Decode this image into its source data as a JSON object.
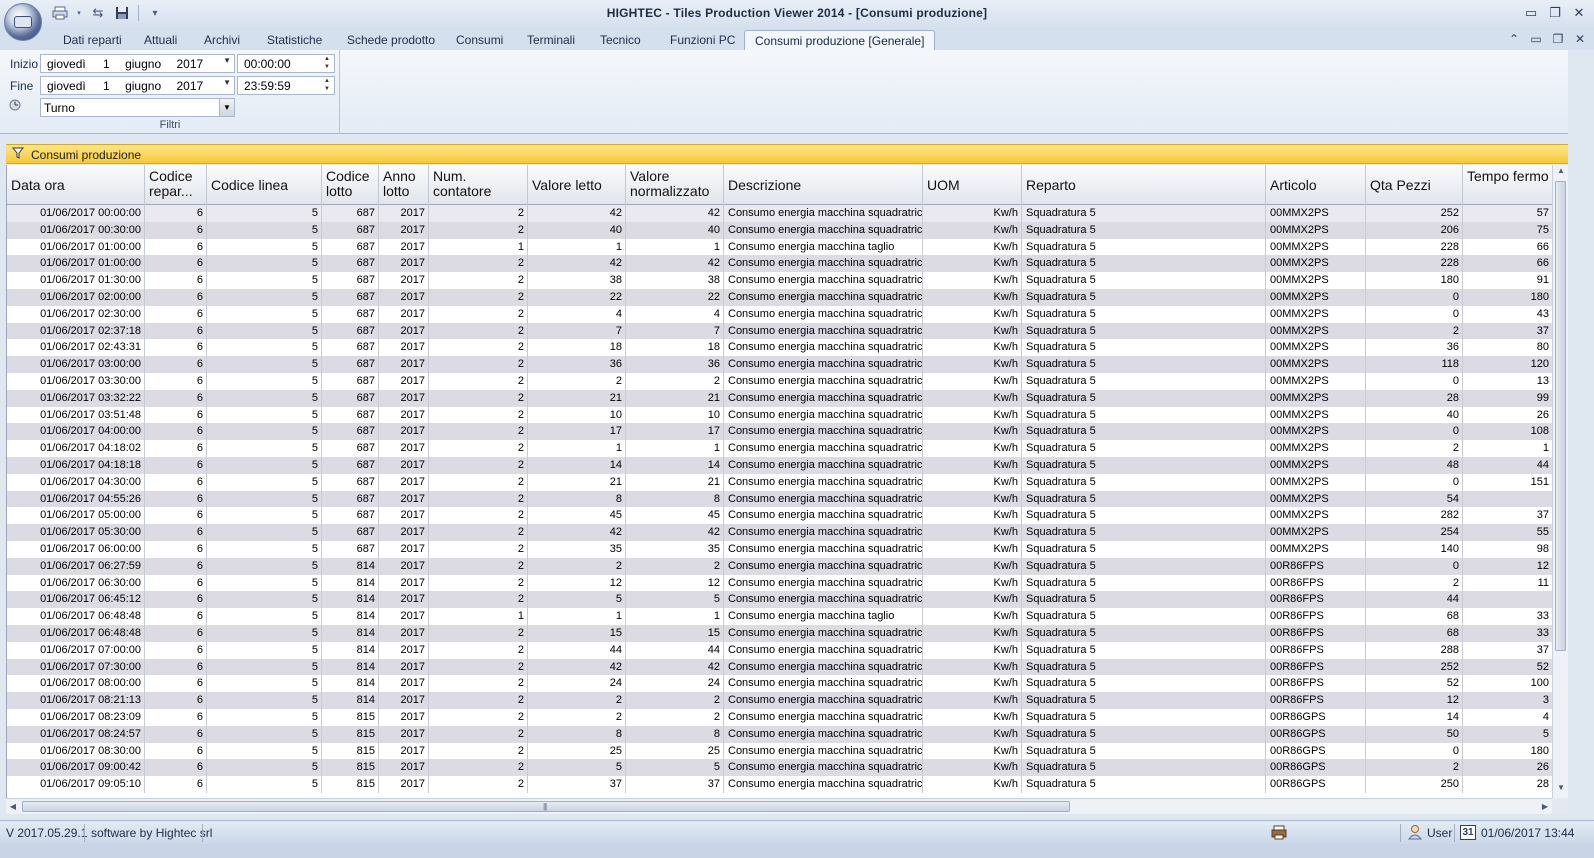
{
  "window": {
    "title": "HIGHTEC - Tiles Production Viewer 2014 - [Consumi produzione]"
  },
  "tabs": [
    "Dati reparti",
    "Attuali",
    "Archivi",
    "Statistiche",
    "Schede prodotto",
    "Consumi",
    "Terminali",
    "Tecnico",
    "Funzioni PC",
    "Consumi produzione [Generale]"
  ],
  "filters": {
    "start_label": "Inizio",
    "end_label": "Fine",
    "start_day": "giovedì",
    "start_num": "1",
    "start_month": "giugno",
    "start_year": "2017",
    "start_time": "00:00:00",
    "end_day": "giovedì",
    "end_num": "1",
    "end_month": "giugno",
    "end_year": "2017",
    "end_time": "23:59:59",
    "shift_value": "Turno",
    "group_caption": "Filtri"
  },
  "panel": {
    "title": "Consumi produzione"
  },
  "columns": [
    "Data ora",
    "Codice repar...",
    "Codice linea",
    "Codice lotto",
    "Anno lotto",
    "Num. contatore",
    "Valore letto",
    "Valore normalizzato",
    "Descrizione",
    "UOM",
    "Reparto",
    "Articolo",
    "Qta Pezzi",
    "Tempo fermo"
  ],
  "rows": [
    [
      "01/06/2017 00:00:00",
      "6",
      "5",
      "687",
      "2017",
      "2",
      "42",
      "42",
      "Consumo energia macchina squadratrice",
      "Kw/h",
      "Squadratura 5",
      "00MMX2PS",
      "252",
      "57"
    ],
    [
      "01/06/2017 00:30:00",
      "6",
      "5",
      "687",
      "2017",
      "2",
      "40",
      "40",
      "Consumo energia macchina squadratrice",
      "Kw/h",
      "Squadratura 5",
      "00MMX2PS",
      "206",
      "75"
    ],
    [
      "01/06/2017 01:00:00",
      "6",
      "5",
      "687",
      "2017",
      "1",
      "1",
      "1",
      "Consumo energia macchina taglio",
      "Kw/h",
      "Squadratura 5",
      "00MMX2PS",
      "228",
      "66"
    ],
    [
      "01/06/2017 01:00:00",
      "6",
      "5",
      "687",
      "2017",
      "2",
      "42",
      "42",
      "Consumo energia macchina squadratrice",
      "Kw/h",
      "Squadratura 5",
      "00MMX2PS",
      "228",
      "66"
    ],
    [
      "01/06/2017 01:30:00",
      "6",
      "5",
      "687",
      "2017",
      "2",
      "38",
      "38",
      "Consumo energia macchina squadratrice",
      "Kw/h",
      "Squadratura 5",
      "00MMX2PS",
      "180",
      "91"
    ],
    [
      "01/06/2017 02:00:00",
      "6",
      "5",
      "687",
      "2017",
      "2",
      "22",
      "22",
      "Consumo energia macchina squadratrice",
      "Kw/h",
      "Squadratura 5",
      "00MMX2PS",
      "0",
      "180"
    ],
    [
      "01/06/2017 02:30:00",
      "6",
      "5",
      "687",
      "2017",
      "2",
      "4",
      "4",
      "Consumo energia macchina squadratrice",
      "Kw/h",
      "Squadratura 5",
      "00MMX2PS",
      "0",
      "43"
    ],
    [
      "01/06/2017 02:37:18",
      "6",
      "5",
      "687",
      "2017",
      "2",
      "7",
      "7",
      "Consumo energia macchina squadratrice",
      "Kw/h",
      "Squadratura 5",
      "00MMX2PS",
      "2",
      "37"
    ],
    [
      "01/06/2017 02:43:31",
      "6",
      "5",
      "687",
      "2017",
      "2",
      "18",
      "18",
      "Consumo energia macchina squadratrice",
      "Kw/h",
      "Squadratura 5",
      "00MMX2PS",
      "36",
      "80"
    ],
    [
      "01/06/2017 03:00:00",
      "6",
      "5",
      "687",
      "2017",
      "2",
      "36",
      "36",
      "Consumo energia macchina squadratrice",
      "Kw/h",
      "Squadratura 5",
      "00MMX2PS",
      "118",
      "120"
    ],
    [
      "01/06/2017 03:30:00",
      "6",
      "5",
      "687",
      "2017",
      "2",
      "2",
      "2",
      "Consumo energia macchina squadratrice",
      "Kw/h",
      "Squadratura 5",
      "00MMX2PS",
      "0",
      "13"
    ],
    [
      "01/06/2017 03:32:22",
      "6",
      "5",
      "687",
      "2017",
      "2",
      "21",
      "21",
      "Consumo energia macchina squadratrice",
      "Kw/h",
      "Squadratura 5",
      "00MMX2PS",
      "28",
      "99"
    ],
    [
      "01/06/2017 03:51:48",
      "6",
      "5",
      "687",
      "2017",
      "2",
      "10",
      "10",
      "Consumo energia macchina squadratrice",
      "Kw/h",
      "Squadratura 5",
      "00MMX2PS",
      "40",
      "26"
    ],
    [
      "01/06/2017 04:00:00",
      "6",
      "5",
      "687",
      "2017",
      "2",
      "17",
      "17",
      "Consumo energia macchina squadratrice",
      "Kw/h",
      "Squadratura 5",
      "00MMX2PS",
      "0",
      "108"
    ],
    [
      "01/06/2017 04:18:02",
      "6",
      "5",
      "687",
      "2017",
      "2",
      "1",
      "1",
      "Consumo energia macchina squadratrice",
      "Kw/h",
      "Squadratura 5",
      "00MMX2PS",
      "2",
      "1"
    ],
    [
      "01/06/2017 04:18:18",
      "6",
      "5",
      "687",
      "2017",
      "2",
      "14",
      "14",
      "Consumo energia macchina squadratrice",
      "Kw/h",
      "Squadratura 5",
      "00MMX2PS",
      "48",
      "44"
    ],
    [
      "01/06/2017 04:30:00",
      "6",
      "5",
      "687",
      "2017",
      "2",
      "21",
      "21",
      "Consumo energia macchina squadratrice",
      "Kw/h",
      "Squadratura 5",
      "00MMX2PS",
      "0",
      "151"
    ],
    [
      "01/06/2017 04:55:26",
      "6",
      "5",
      "687",
      "2017",
      "2",
      "8",
      "8",
      "Consumo energia macchina squadratrice",
      "Kw/h",
      "Squadratura 5",
      "00MMX2PS",
      "54",
      ""
    ],
    [
      "01/06/2017 05:00:00",
      "6",
      "5",
      "687",
      "2017",
      "2",
      "45",
      "45",
      "Consumo energia macchina squadratrice",
      "Kw/h",
      "Squadratura 5",
      "00MMX2PS",
      "282",
      "37"
    ],
    [
      "01/06/2017 05:30:00",
      "6",
      "5",
      "687",
      "2017",
      "2",
      "42",
      "42",
      "Consumo energia macchina squadratrice",
      "Kw/h",
      "Squadratura 5",
      "00MMX2PS",
      "254",
      "55"
    ],
    [
      "01/06/2017 06:00:00",
      "6",
      "5",
      "687",
      "2017",
      "2",
      "35",
      "35",
      "Consumo energia macchina squadratrice",
      "Kw/h",
      "Squadratura 5",
      "00MMX2PS",
      "140",
      "98"
    ],
    [
      "01/06/2017 06:27:59",
      "6",
      "5",
      "814",
      "2017",
      "2",
      "2",
      "2",
      "Consumo energia macchina squadratrice",
      "Kw/h",
      "Squadratura 5",
      "00R86FPS",
      "0",
      "12"
    ],
    [
      "01/06/2017 06:30:00",
      "6",
      "5",
      "814",
      "2017",
      "2",
      "12",
      "12",
      "Consumo energia macchina squadratrice",
      "Kw/h",
      "Squadratura 5",
      "00R86FPS",
      "2",
      "11"
    ],
    [
      "01/06/2017 06:45:12",
      "6",
      "5",
      "814",
      "2017",
      "2",
      "5",
      "5",
      "Consumo energia macchina squadratrice",
      "Kw/h",
      "Squadratura 5",
      "00R86FPS",
      "44",
      ""
    ],
    [
      "01/06/2017 06:48:48",
      "6",
      "5",
      "814",
      "2017",
      "1",
      "1",
      "1",
      "Consumo energia macchina taglio",
      "Kw/h",
      "Squadratura 5",
      "00R86FPS",
      "68",
      "33"
    ],
    [
      "01/06/2017 06:48:48",
      "6",
      "5",
      "814",
      "2017",
      "2",
      "15",
      "15",
      "Consumo energia macchina squadratrice",
      "Kw/h",
      "Squadratura 5",
      "00R86FPS",
      "68",
      "33"
    ],
    [
      "01/06/2017 07:00:00",
      "6",
      "5",
      "814",
      "2017",
      "2",
      "44",
      "44",
      "Consumo energia macchina squadratrice",
      "Kw/h",
      "Squadratura 5",
      "00R86FPS",
      "288",
      "37"
    ],
    [
      "01/06/2017 07:30:00",
      "6",
      "5",
      "814",
      "2017",
      "2",
      "42",
      "42",
      "Consumo energia macchina squadratrice",
      "Kw/h",
      "Squadratura 5",
      "00R86FPS",
      "252",
      "52"
    ],
    [
      "01/06/2017 08:00:00",
      "6",
      "5",
      "814",
      "2017",
      "2",
      "24",
      "24",
      "Consumo energia macchina squadratrice",
      "Kw/h",
      "Squadratura 5",
      "00R86FPS",
      "52",
      "100"
    ],
    [
      "01/06/2017 08:21:13",
      "6",
      "5",
      "814",
      "2017",
      "2",
      "2",
      "2",
      "Consumo energia macchina squadratrice",
      "Kw/h",
      "Squadratura 5",
      "00R86FPS",
      "12",
      "3"
    ],
    [
      "01/06/2017 08:23:09",
      "6",
      "5",
      "815",
      "2017",
      "2",
      "2",
      "2",
      "Consumo energia macchina squadratrice",
      "Kw/h",
      "Squadratura 5",
      "00R86GPS",
      "14",
      "4"
    ],
    [
      "01/06/2017 08:24:57",
      "6",
      "5",
      "815",
      "2017",
      "2",
      "8",
      "8",
      "Consumo energia macchina squadratrice",
      "Kw/h",
      "Squadratura 5",
      "00R86GPS",
      "50",
      "5"
    ],
    [
      "01/06/2017 08:30:00",
      "6",
      "5",
      "815",
      "2017",
      "2",
      "25",
      "25",
      "Consumo energia macchina squadratrice",
      "Kw/h",
      "Squadratura 5",
      "00R86GPS",
      "0",
      "180"
    ],
    [
      "01/06/2017 09:00:42",
      "6",
      "5",
      "815",
      "2017",
      "2",
      "5",
      "5",
      "Consumo energia macchina squadratrice",
      "Kw/h",
      "Squadratura 5",
      "00R86GPS",
      "2",
      "26"
    ],
    [
      "01/06/2017 09:05:10",
      "6",
      "5",
      "815",
      "2017",
      "2",
      "37",
      "37",
      "Consumo energia macchina squadratrice",
      "Kw/h",
      "Squadratura 5",
      "00R86GPS",
      "250",
      "28"
    ]
  ],
  "status": {
    "version": "V 2017.05.29.1",
    "vendor": "software by Hightec srl",
    "user": "User",
    "calendar_day": "31",
    "datetime": "01/06/2017 13:44"
  },
  "icons": {
    "orb": "app-menu-orb",
    "qat": [
      "print-icon",
      "refresh-icon",
      "save-icon",
      "customize-icon"
    ]
  }
}
